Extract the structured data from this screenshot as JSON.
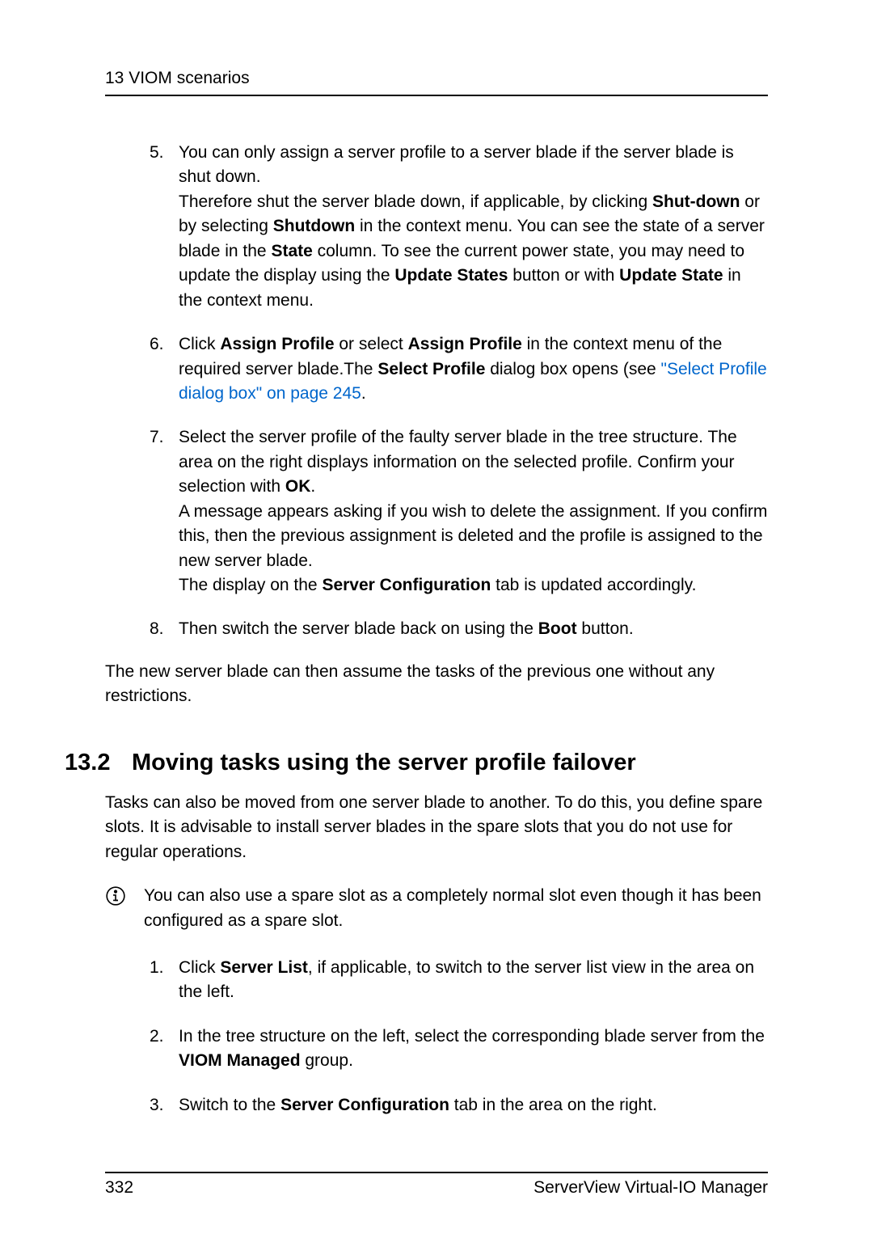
{
  "header": {
    "chapter_label": "13 VIOM scenarios"
  },
  "list1": {
    "item5": {
      "number": "5.",
      "text_part1": "You can only assign a server profile to a server blade if the server blade is shut down.",
      "text_part2a": "Therefore shut the server blade down, if applicable, by clicking ",
      "bold1": "Shut-down",
      "text_part2b": " or by selecting ",
      "bold2": "Shutdown",
      "text_part2c": " in the context menu. You can see the state of a server blade in the ",
      "bold3": "State",
      "text_part2d": " column. To see the current power state, you may need to update the display using the ",
      "bold4": "Update States",
      "text_part2e": " button or with ",
      "bold5": "Update State",
      "text_part2f": " in the context menu."
    },
    "item6": {
      "number": "6.",
      "text_part1": "Click ",
      "bold1": "Assign Profile",
      "text_part2": " or select ",
      "bold2": "Assign Profile",
      "text_part3": " in the context menu of the required server blade.The ",
      "bold3": "Select Profile",
      "text_part4": " dialog box opens (see ",
      "link1": "\"Select Profile dialog box\" on page 245",
      "text_part5": "."
    },
    "item7": {
      "number": "7.",
      "text_part1": "Select the server profile of the faulty server blade in the tree structure. The area on the right displays information on the selected profile. Confirm your selection with ",
      "bold1": "OK",
      "text_part2": ".",
      "text_part3": "A message appears asking if you wish to delete the assignment. If you confirm this, then the previous assignment is deleted and the profile is assigned to the new server blade.",
      "text_part4a": "The display on the ",
      "bold2": "Server Configuration",
      "text_part4b": " tab is updated accordingly."
    },
    "item8": {
      "number": "8.",
      "text_part1": "Then switch the server blade back on using the ",
      "bold1": "Boot",
      "text_part2": " button."
    }
  },
  "closing": "The new server blade can then assume the tasks of the previous one without any restrictions.",
  "section": {
    "number": "13.2",
    "title": "Moving tasks using the server profile failover",
    "intro": "Tasks can also be moved from one server blade to another. To do this, you define spare slots. It is advisable to install server blades in the spare slots that you do not use for regular operations.",
    "info_text": "You can also use a spare slot as a completely normal slot even though it has been configured as a spare slot."
  },
  "list2": {
    "item1": {
      "number": "1.",
      "text_part1": "Click ",
      "bold1": "Server List",
      "text_part2": ", if applicable, to switch to the server list view in the area on the left."
    },
    "item2": {
      "number": "2.",
      "text_part1": "In the tree structure on the left, select the corresponding blade server from the ",
      "bold1": "VIOM Managed",
      "text_part2": " group."
    },
    "item3": {
      "number": "3.",
      "text_part1": "Switch to the ",
      "bold1": "Server Configuration",
      "text_part2": " tab in the area on the right."
    }
  },
  "footer": {
    "page_number": "332",
    "product_name": "ServerView Virtual-IO Manager"
  }
}
